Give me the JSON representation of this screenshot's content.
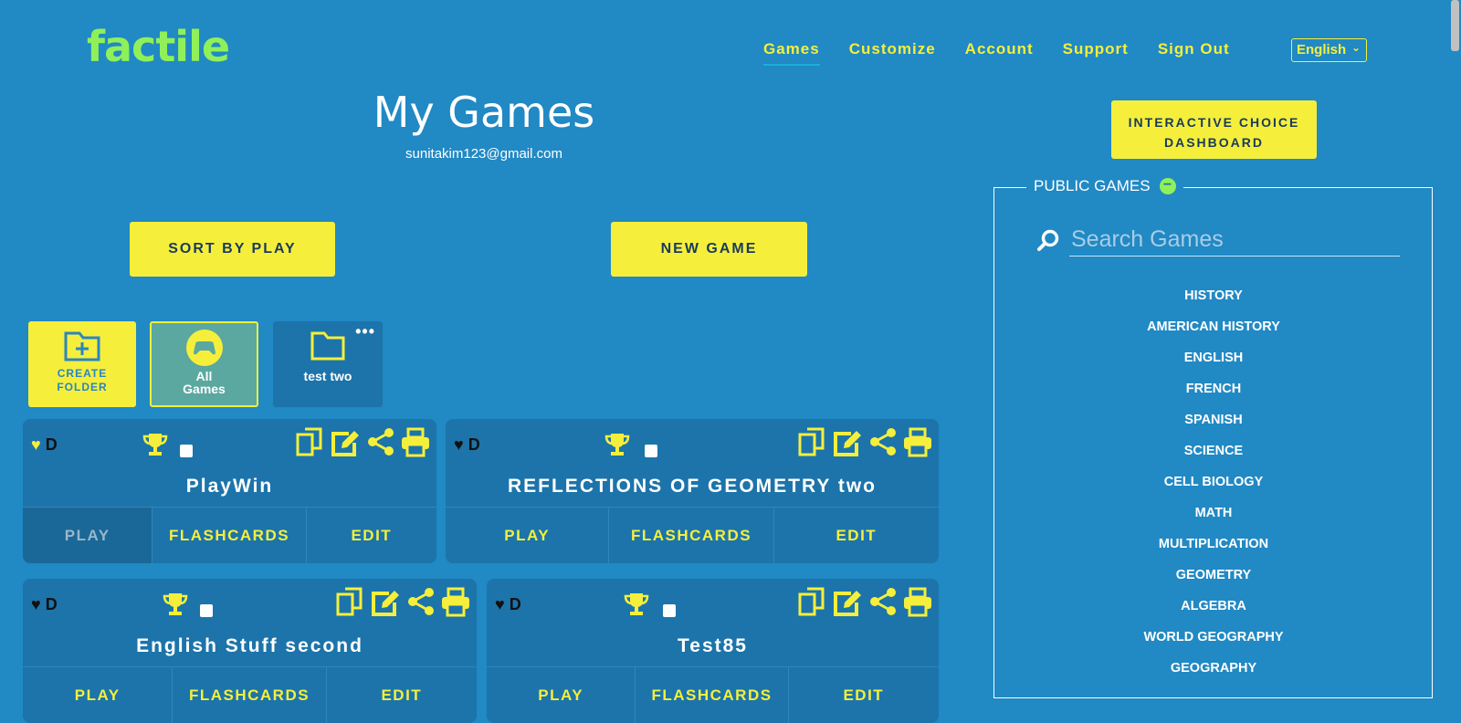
{
  "app": {
    "logo": "factile"
  },
  "nav": {
    "items": [
      "Games",
      "Customize",
      "Account",
      "Support",
      "Sign Out"
    ],
    "active": "Games",
    "language": "English"
  },
  "header": {
    "title": "My Games",
    "email": "sunitakim123@gmail.com"
  },
  "buttons": {
    "sort": "SORT BY PLAY",
    "new_game": "NEW GAME",
    "dashboard": "INTERACTIVE CHOICE DASHBOARD"
  },
  "folders": {
    "create": "CREATE FOLDER",
    "all": "All Games",
    "custom": "test two"
  },
  "cards": [
    {
      "heart_letter": "D",
      "title": "PlayWin",
      "actions": [
        "PLAY",
        "FLASHCARDS",
        "EDIT"
      ],
      "favorite": true
    },
    {
      "heart_letter": "D",
      "title": "REFLECTIONS OF GEOMETRY two",
      "actions": [
        "PLAY",
        "FLASHCARDS",
        "EDIT"
      ],
      "favorite": false
    },
    {
      "heart_letter": "D",
      "title": "English Stuff second",
      "actions": [
        "PLAY",
        "FLASHCARDS",
        "EDIT"
      ],
      "favorite": false
    },
    {
      "heart_letter": "D",
      "title": "Test85",
      "actions": [
        "PLAY",
        "FLASHCARDS",
        "EDIT"
      ],
      "favorite": false
    }
  ],
  "public_games": {
    "title": "PUBLIC GAMES",
    "search_placeholder": "Search Games",
    "categories": [
      "HISTORY",
      "AMERICAN HISTORY",
      "ENGLISH",
      "FRENCH",
      "SPANISH",
      "SCIENCE",
      "CELL BIOLOGY",
      "MATH",
      "MULTIPLICATION",
      "GEOMETRY",
      "ALGEBRA",
      "WORLD GEOGRAPHY",
      "GEOGRAPHY"
    ]
  },
  "colors": {
    "background": "#2189c4",
    "accent_yellow": "#f5ef3c",
    "logo_green": "#8ff05a",
    "card": "#1c74aa"
  },
  "icons": [
    "search-icon",
    "heart-icon",
    "trophy-icon",
    "copy-icon",
    "edit-icon",
    "share-icon",
    "print-icon",
    "folder-icon",
    "gamepad-icon",
    "more-icon",
    "minus-icon"
  ]
}
